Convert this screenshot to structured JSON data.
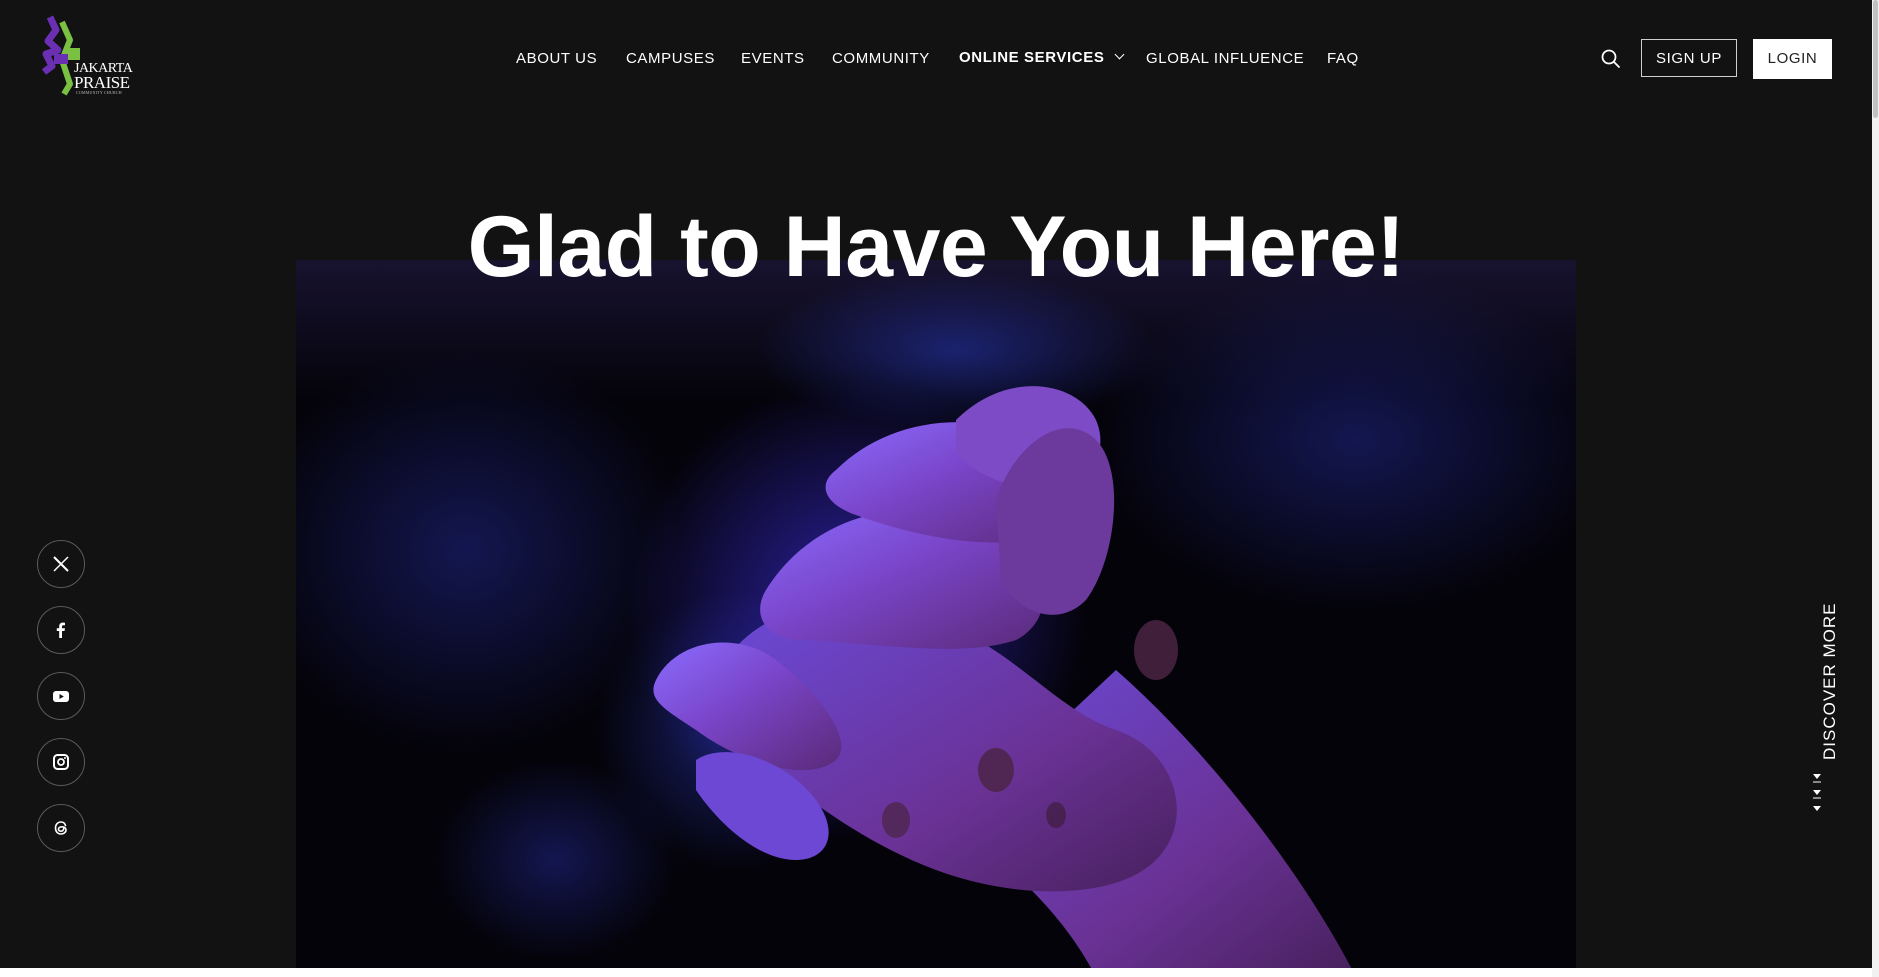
{
  "brand": {
    "logo_line1": "JAKARTA",
    "logo_line2": "PRAISE",
    "logo_sub": "COMMUNITY CHURCH",
    "colors": {
      "purple": "#6a2fb3",
      "green": "#7ac143"
    }
  },
  "nav": {
    "items": [
      {
        "label": "ABOUT US"
      },
      {
        "label": "CAMPUSES"
      },
      {
        "label": "EVENTS"
      },
      {
        "label": "COMMUNITY"
      },
      {
        "label": "ONLINE SERVICES",
        "has_dropdown": true
      },
      {
        "label": "GLOBAL INFLUENCE"
      },
      {
        "label": "FAQ"
      }
    ]
  },
  "header_actions": {
    "search_icon": "search-icon",
    "signup_label": "SIGN UP",
    "login_label": "LOGIN"
  },
  "hero": {
    "title": "Glad to Have You Here!",
    "image_description_icon": "praying-hands-image"
  },
  "social": [
    {
      "name": "x-twitter-icon"
    },
    {
      "name": "facebook-icon"
    },
    {
      "name": "youtube-icon"
    },
    {
      "name": "instagram-icon"
    },
    {
      "name": "threads-icon"
    }
  ],
  "discover": {
    "label": "DISCOVER MORE"
  },
  "colors": {
    "background": "#121212",
    "text": "#ffffff",
    "accent_glow": "#5a3cff"
  }
}
